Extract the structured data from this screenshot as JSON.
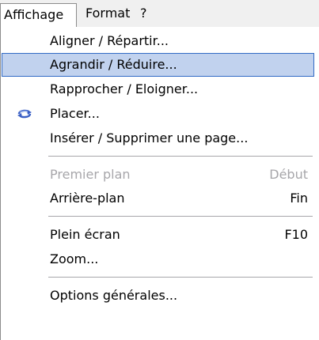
{
  "menubar": {
    "items": [
      {
        "label": "Affichage"
      },
      {
        "label": "Format"
      },
      {
        "label": "?"
      }
    ]
  },
  "menu": {
    "items": [
      {
        "label": "Aligner / Répartir...",
        "shortcut": "",
        "state": "normal"
      },
      {
        "label": "Agrandir / Réduire...",
        "shortcut": "",
        "state": "highlighted"
      },
      {
        "label": "Rapprocher / Eloigner...",
        "shortcut": "",
        "state": "normal"
      },
      {
        "label": "Placer...",
        "shortcut": "",
        "state": "normal",
        "icon": "rotate-arrows-icon"
      },
      {
        "label": "Insérer / Supprimer une page...",
        "shortcut": "",
        "state": "normal"
      },
      {
        "label": "Premier plan",
        "shortcut": "Début",
        "state": "disabled"
      },
      {
        "label": "Arrière-plan",
        "shortcut": "Fin",
        "state": "normal"
      },
      {
        "label": "Plein écran",
        "shortcut": "F10",
        "state": "normal"
      },
      {
        "label": "Zoom...",
        "shortcut": "",
        "state": "normal"
      },
      {
        "label": "Options générales...",
        "shortcut": "",
        "state": "normal"
      }
    ]
  },
  "colors": {
    "highlight_bg": "#c1d2ee",
    "highlight_border": "#316ac5",
    "disabled_text": "#a7a6aa",
    "menubar_bg": "#f0f0f0"
  }
}
